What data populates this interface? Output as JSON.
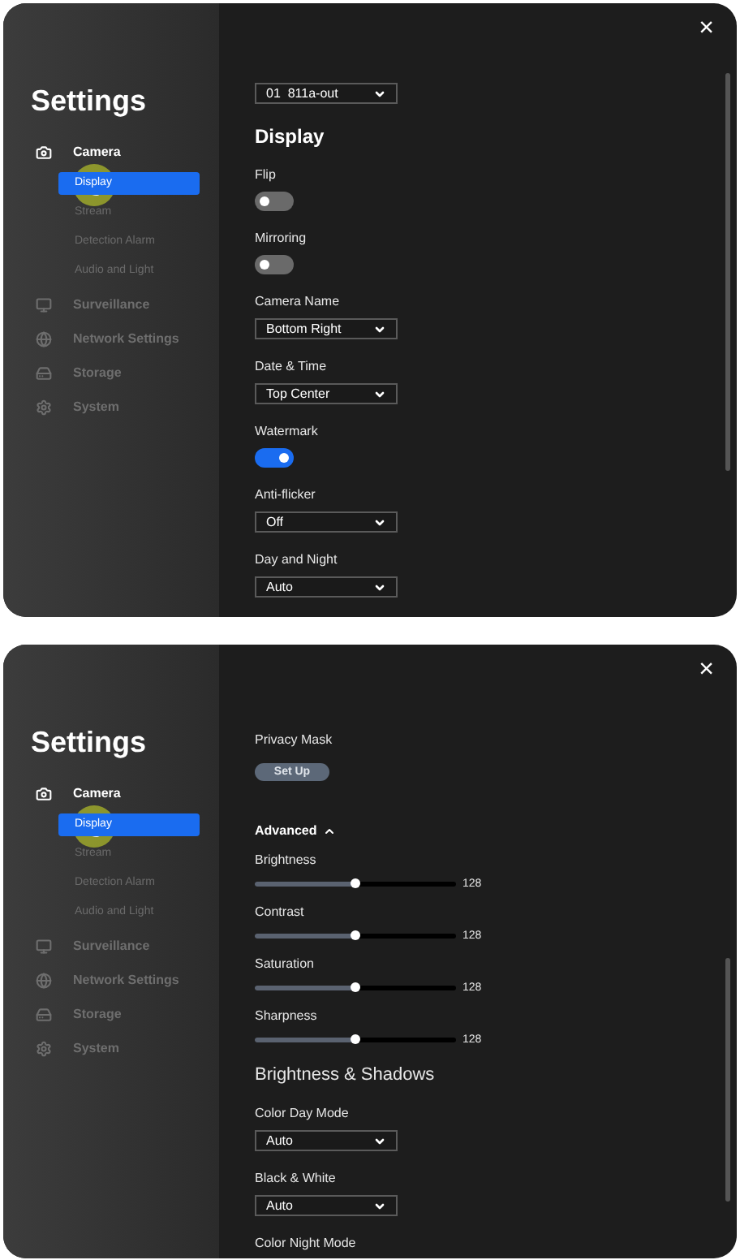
{
  "screens": [
    {
      "close": "×",
      "sidebar": {
        "title": "Settings",
        "items": [
          {
            "label": "Camera",
            "selected": true,
            "children": [
              {
                "label": "Display",
                "selected": true
              },
              {
                "label": "Stream",
                "selected": false
              },
              {
                "label": "Detection Alarm",
                "selected": false
              },
              {
                "label": "Audio and Light",
                "selected": false
              }
            ]
          },
          {
            "label": "Surveillance",
            "selected": false
          },
          {
            "label": "Network Settings",
            "selected": false
          },
          {
            "label": "Storage",
            "selected": false
          },
          {
            "label": "System",
            "selected": false
          }
        ]
      },
      "content": [
        {
          "kind": "select",
          "value": "01  811a-out"
        },
        {
          "kind": "heading",
          "text": "Display"
        },
        {
          "kind": "toggle",
          "label": "Flip",
          "on": false
        },
        {
          "kind": "toggle",
          "label": "Mirroring",
          "on": false
        },
        {
          "kind": "select",
          "label": "Camera Name",
          "value": "Bottom Right"
        },
        {
          "kind": "select",
          "label": "Date & Time",
          "value": "Top Center"
        },
        {
          "kind": "toggle",
          "label": "Watermark",
          "on": true
        },
        {
          "kind": "select",
          "label": "Anti-flicker",
          "value": "Off"
        },
        {
          "kind": "select",
          "label": "Day and Night",
          "value": "Auto"
        }
      ]
    },
    {
      "close": "×",
      "sidebar": {
        "title": "Settings",
        "items": [
          {
            "label": "Camera",
            "selected": true,
            "children": [
              {
                "label": "Display",
                "selected": true
              },
              {
                "label": "Stream",
                "selected": false
              },
              {
                "label": "Detection Alarm",
                "selected": false
              },
              {
                "label": "Audio and Light",
                "selected": false
              }
            ]
          },
          {
            "label": "Surveillance",
            "selected": false
          },
          {
            "label": "Network Settings",
            "selected": false
          },
          {
            "label": "Storage",
            "selected": false
          },
          {
            "label": "System",
            "selected": false
          }
        ]
      },
      "content": [
        {
          "kind": "button",
          "label": "Privacy Mask",
          "button": "Set Up"
        },
        {
          "kind": "section",
          "text": "Advanced",
          "expanded": true
        },
        {
          "kind": "slider",
          "label": "Brightness",
          "level": 0.5,
          "reading": "128"
        },
        {
          "kind": "slider",
          "label": "Contrast",
          "level": 0.5,
          "reading": "128"
        },
        {
          "kind": "slider",
          "label": "Saturation",
          "level": 0.5,
          "reading": "128"
        },
        {
          "kind": "slider",
          "label": "Sharpness",
          "level": 0.5,
          "reading": "128"
        },
        {
          "kind": "subheading",
          "text": "Brightness & Shadows"
        },
        {
          "kind": "select",
          "label": "Color Day Mode",
          "value": "Auto"
        },
        {
          "kind": "select",
          "label": "Black & White",
          "value": "Auto"
        },
        {
          "kind": "label",
          "text": "Color Night Mode"
        }
      ]
    }
  ]
}
